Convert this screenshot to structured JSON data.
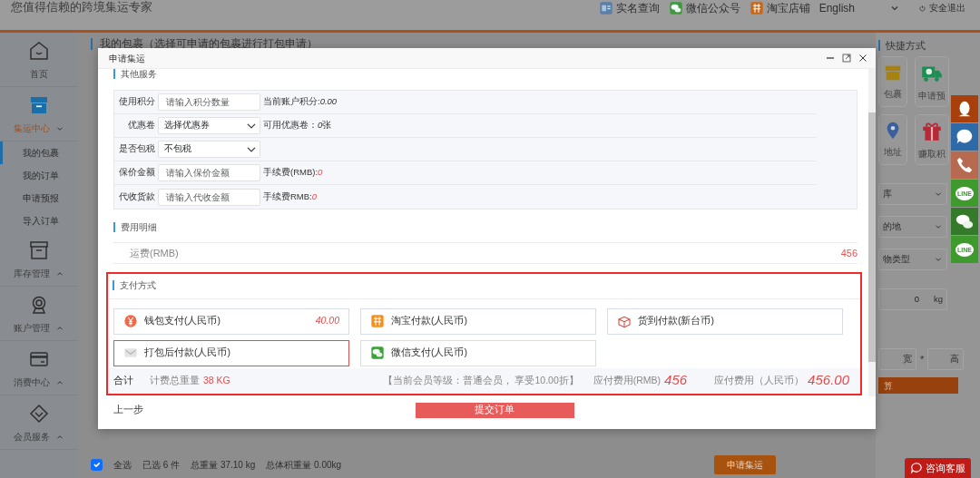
{
  "header": {
    "tagline": "您值得信赖的跨境集运专家",
    "links": [
      {
        "label": "实名查询"
      },
      {
        "label": "微信公众号"
      },
      {
        "label": "淘宝店铺"
      }
    ],
    "language": "English",
    "logout": "安全退出"
  },
  "sidebar": {
    "items": [
      {
        "label": "首页",
        "selected": false
      },
      {
        "label": "集运中心",
        "selected": true,
        "expanded": true,
        "children": [
          {
            "label": "我的包裹",
            "selected": true
          },
          {
            "label": "我的订单",
            "selected": false
          },
          {
            "label": "申请预报",
            "selected": false
          },
          {
            "label": "导入订单",
            "selected": false
          }
        ]
      },
      {
        "label": "库存管理",
        "selected": false,
        "expanded": false
      },
      {
        "label": "账户管理",
        "selected": false,
        "expanded": false
      },
      {
        "label": "消费中心",
        "selected": false,
        "expanded": false
      },
      {
        "label": "会员服务",
        "selected": false,
        "expanded": false
      }
    ]
  },
  "main": {
    "title": "我的包裹（选择可申请的包裹进行打包申请）"
  },
  "shortcuts": {
    "title": "快捷方式",
    "tiles": [
      {
        "label": "包裹"
      },
      {
        "label": "申请预"
      },
      {
        "label": "地址"
      },
      {
        "label": "赚取积"
      }
    ],
    "fields": [
      {
        "kind": "select",
        "value": "库"
      },
      {
        "kind": "select",
        "value": "的地"
      },
      {
        "kind": "select",
        "value": "物类型"
      },
      {
        "kind": "weight",
        "value": "0",
        "unit": "kg"
      },
      {
        "kind": "dims",
        "width_label": "宽",
        "separator": "*",
        "height_label": "高"
      },
      {
        "kind": "button",
        "label": "算"
      }
    ]
  },
  "footer_bar": {
    "select_all": {
      "label": "全选",
      "checked": true
    },
    "selected_count": "已选 6 件",
    "total_weight": "总重量 37.10 kg",
    "volume_weight": "总体积重量 0.00kg",
    "apply": "申请集运"
  },
  "float_buttons": [
    {
      "kind": "penguin"
    },
    {
      "kind": "chat"
    },
    {
      "kind": "phone"
    },
    {
      "kind": "line",
      "label": "LINE"
    },
    {
      "kind": "bubbles"
    },
    {
      "kind": "line",
      "label": "LINE"
    }
  ],
  "consult": "咨询客服",
  "dialog": {
    "title": "申请集运",
    "other_services": {
      "heading": "其他服务",
      "rows": [
        {
          "kind": "input",
          "label": "使用积分",
          "placeholder": "请输入积分数量",
          "note": "当前账户积分:",
          "note_value": "0.00",
          "note_emphasis": false
        },
        {
          "kind": "select",
          "label": "优惠卷",
          "value": "选择优惠券",
          "note": "可用优惠卷：",
          "note_value": "0",
          "note_suffix": "张",
          "note_emphasis": false
        },
        {
          "kind": "select",
          "label": "是否包税",
          "value": "不包税"
        },
        {
          "kind": "input",
          "label": "保价金额",
          "placeholder": "请输入保价金额",
          "note": "手续费(RMB):",
          "note_value": "0",
          "note_emphasis": true
        },
        {
          "kind": "input",
          "label": "代收货款",
          "placeholder": "请输入代收金额",
          "note": "手续费RMB:",
          "note_value": "0",
          "note_emphasis": true
        }
      ]
    },
    "fees": {
      "heading": "费用明细",
      "rows": [
        {
          "label": "运费(RMB)",
          "value": "456"
        }
      ]
    },
    "payment": {
      "heading": "支付方式",
      "options": [
        {
          "label": "钱包支付(人民币)",
          "balance": "40.00",
          "selected": false
        },
        {
          "label": "淘宝付款(人民币)",
          "selected": false
        },
        {
          "label": "货到付款(新台币)",
          "selected": false
        },
        {
          "label": "打包后付款(人民币)",
          "selected": true
        },
        {
          "label": "微信支付(人民币)",
          "selected": false
        }
      ]
    },
    "summary": {
      "total_label": "合计",
      "weight_label": "计费总重量",
      "weight": "38 KG",
      "member_note": "【当前会员等级：普通会员， 享受10.00折】",
      "due_rmb_label": "应付费用(RMB)",
      "due_rmb": "456",
      "due_cny_label": "应付费用（人民币）",
      "due_cny": "456.00"
    },
    "back": "上一步",
    "submit": "提交订单"
  }
}
